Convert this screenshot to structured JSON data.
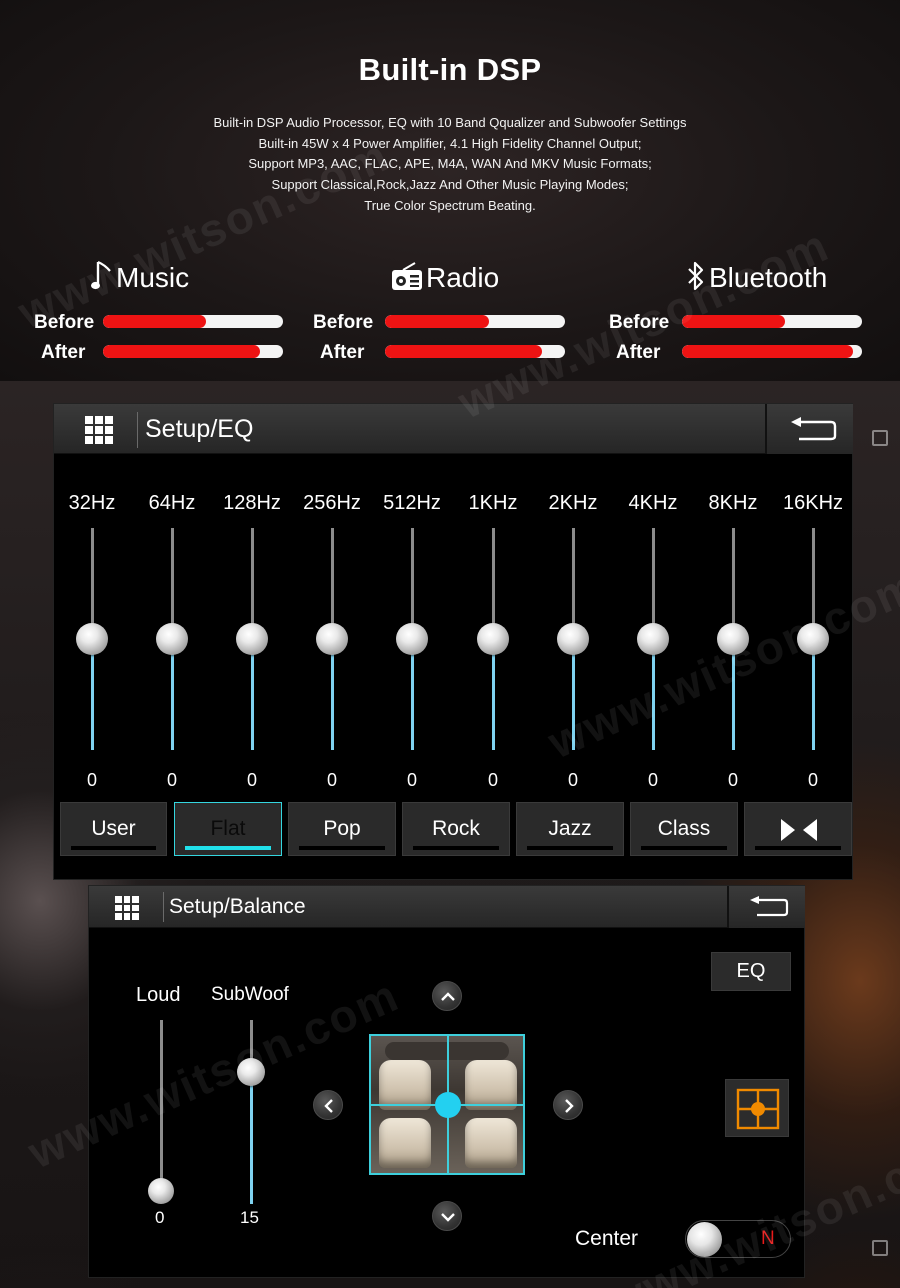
{
  "hero": {
    "title": "Built-in DSP",
    "description": [
      "Built-in DSP Audio Processor, EQ with 10 Band Qqualizer and Subwoofer Settings",
      "Built-in 45W x 4 Power Amplifier, 4.1 High Fidelity Channel Output;",
      "Support MP3, AAC, FLAC, APE, M4A, WAN And MKV Music Formats;",
      "Support Classical,Rock,Jazz And Other Music Playing Modes;",
      "True Color Spectrum Beating."
    ]
  },
  "comparison": [
    {
      "label": "Music",
      "icon": "music-note-icon",
      "before_label": "Before",
      "after_label": "After",
      "before": 0.57,
      "after": 0.87
    },
    {
      "label": "Radio",
      "icon": "radio-icon",
      "before_label": "Before",
      "after_label": "After",
      "before": 0.58,
      "after": 0.87
    },
    {
      "label": "Bluetooth",
      "icon": "bluetooth-icon",
      "before_label": "Before",
      "after_label": "After",
      "before": 0.57,
      "after": 0.95
    }
  ],
  "eq": {
    "title": "Setup/EQ",
    "bands": [
      {
        "label": "32Hz",
        "value": "0"
      },
      {
        "label": "64Hz",
        "value": "0"
      },
      {
        "label": "128Hz",
        "value": "0"
      },
      {
        "label": "256Hz",
        "value": "0"
      },
      {
        "label": "512Hz",
        "value": "0"
      },
      {
        "label": "1KHz",
        "value": "0"
      },
      {
        "label": "2KHz",
        "value": "0"
      },
      {
        "label": "4KHz",
        "value": "0"
      },
      {
        "label": "8KHz",
        "value": "0"
      },
      {
        "label": "16KHz",
        "value": "0"
      }
    ],
    "presets": [
      "User",
      "Flat",
      "Pop",
      "Rock",
      "Jazz",
      "Class"
    ],
    "active_preset": "Flat",
    "accent_color": "#21e0ea"
  },
  "balance": {
    "title": "Setup/Balance",
    "loud_label": "Loud",
    "loud_value": "0",
    "subwoofer_label": "SubWoof",
    "subwoofer_value": "15",
    "eq_button": "EQ",
    "center_label": "Center",
    "center_toggle": "N"
  },
  "watermark": "www.witson.com",
  "colors": {
    "bar_red": "#ee1313",
    "slider_blue": "#7fd3f0",
    "highlight_cyan": "#3ecfdc",
    "focus_orange": "#f08a00"
  }
}
